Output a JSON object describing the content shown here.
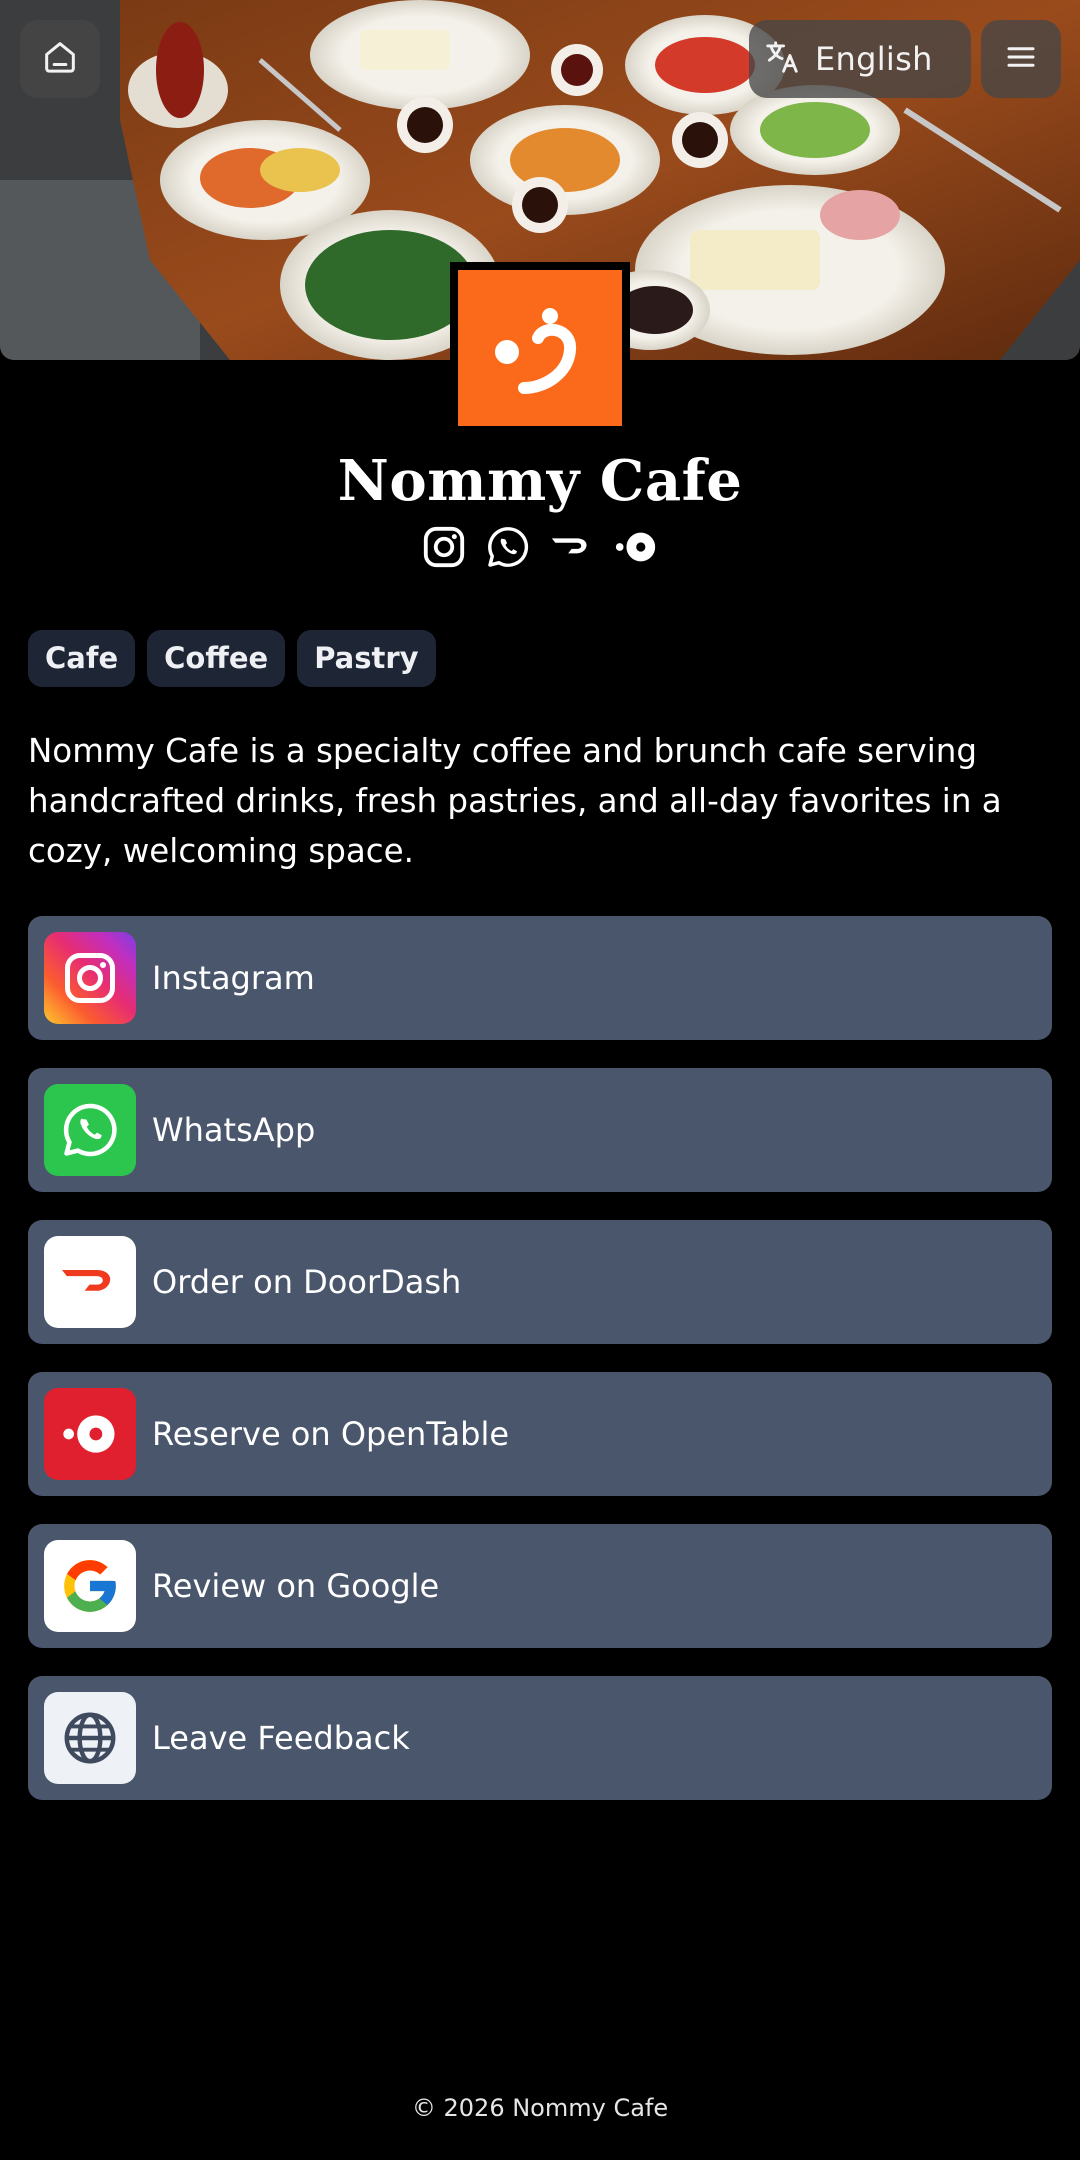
{
  "header": {
    "home_icon": "home-icon",
    "language_icon": "translate-icon",
    "language_label": "English",
    "menu_icon": "menu-icon"
  },
  "profile": {
    "name": "Nommy Cafe",
    "logo_color": "#fb6a1b",
    "social_icons": [
      "instagram-icon",
      "whatsapp-icon",
      "doordash-icon",
      "opentable-icon"
    ]
  },
  "tags": [
    "Cafe",
    "Coffee",
    "Pastry"
  ],
  "description": "Nommy Cafe is a specialty coffee and brunch cafe serving handcrafted drinks, fresh pastries, and all-day favorites in a cozy, welcoming space.",
  "links": [
    {
      "label": "Instagram",
      "icon": "instagram-icon"
    },
    {
      "label": "WhatsApp",
      "icon": "whatsapp-icon"
    },
    {
      "label": "Order on DoorDash",
      "icon": "doordash-icon"
    },
    {
      "label": "Reserve on OpenTable",
      "icon": "opentable-icon"
    },
    {
      "label": "Review on Google",
      "icon": "google-icon"
    },
    {
      "label": "Leave Feedback",
      "icon": "globe-icon"
    }
  ],
  "footer": {
    "copyright": "© 2026 Nommy Cafe"
  },
  "colors": {
    "background": "#000000",
    "link_card": "#4a566c",
    "tag_chip": "#1e2535",
    "brand_orange": "#fb6a1b"
  }
}
